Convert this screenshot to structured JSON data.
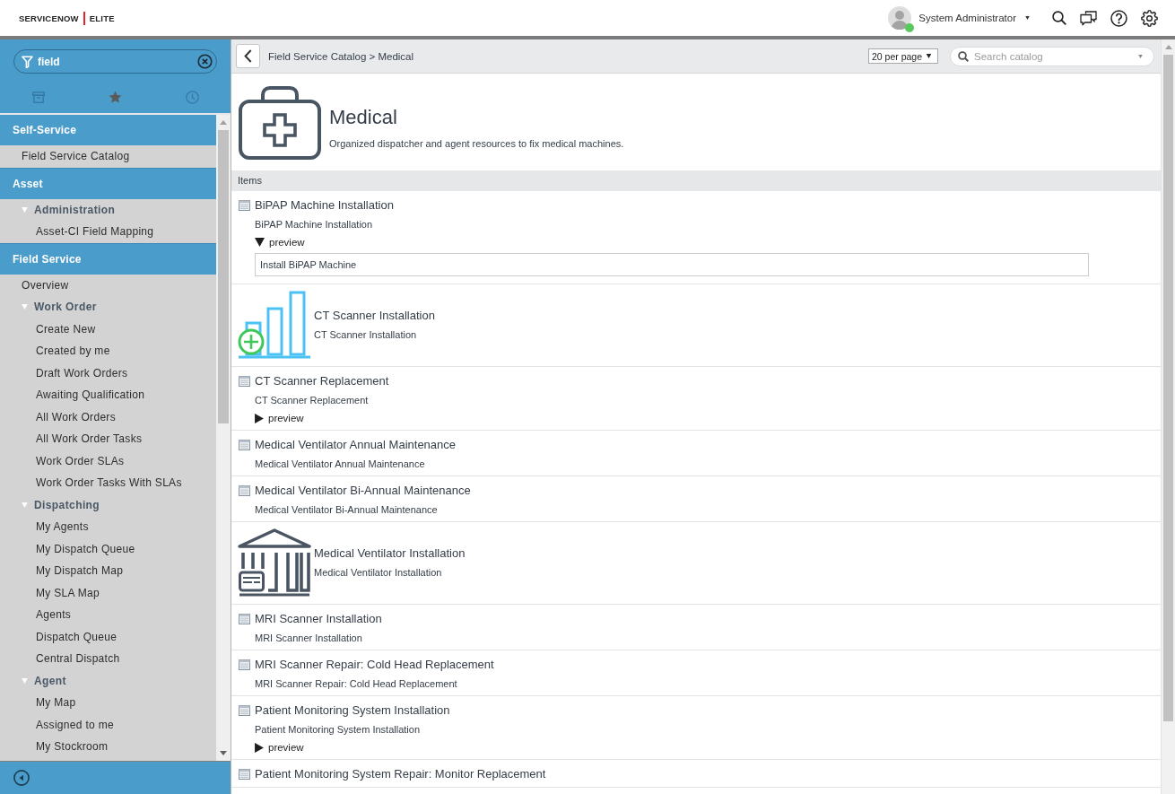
{
  "header": {
    "logo": {
      "brand": "SERVICENOW",
      "edition": "ELITE"
    },
    "user": {
      "name": "System Administrator",
      "online": true
    }
  },
  "nav": {
    "filter": {
      "value": "field"
    },
    "tabs": [
      {
        "selected": false
      },
      {
        "selected": true
      },
      {
        "selected": false
      }
    ],
    "sections": [
      {
        "title": "Self-Service",
        "children": [
          {
            "label": "Field Service Catalog"
          }
        ]
      },
      {
        "title": "Asset",
        "children": [
          {
            "label": "Administration",
            "expanded": true,
            "children": [
              {
                "label": "Asset-CI Field Mapping"
              }
            ]
          }
        ]
      },
      {
        "title": "Field Service",
        "children": [
          {
            "label": "Overview"
          },
          {
            "label": "Work Order",
            "expanded": true,
            "children": [
              {
                "label": "Create New"
              },
              {
                "label": "Created by me"
              },
              {
                "label": "Draft Work Orders"
              },
              {
                "label": "Awaiting Qualification"
              },
              {
                "label": "All Work Orders"
              },
              {
                "label": "All Work Order Tasks"
              },
              {
                "label": "Work Order SLAs"
              },
              {
                "label": "Work Order Tasks With SLAs"
              }
            ]
          },
          {
            "label": "Dispatching",
            "expanded": true,
            "children": [
              {
                "label": "My Agents"
              },
              {
                "label": "My Dispatch Queue"
              },
              {
                "label": "My Dispatch Map"
              },
              {
                "label": "My SLA Map"
              },
              {
                "label": "Agents"
              },
              {
                "label": "Dispatch Queue"
              },
              {
                "label": "Central Dispatch"
              }
            ]
          },
          {
            "label": "Agent",
            "expanded": true,
            "children": [
              {
                "label": "My Map"
              },
              {
                "label": "Assigned to me"
              },
              {
                "label": "My Stockroom"
              }
            ]
          }
        ]
      }
    ]
  },
  "toolbar": {
    "breadcrumb": "Field Service Catalog > Medical",
    "per_page": "20 per page",
    "search": {
      "placeholder": "Search catalog"
    }
  },
  "category": {
    "title": "Medical",
    "description": "Organized dispatcher and agent resources to fix medical machines."
  },
  "items_heading": "Items",
  "items": [
    {
      "kind": "standard",
      "title": "BiPAP Machine Installation",
      "description": "BiPAP Machine Installation",
      "preview": {
        "label": "preview",
        "expanded": true,
        "text": "Install BiPAP Machine"
      }
    },
    {
      "kind": "chart",
      "title": "CT Scanner Installation",
      "description": "CT Scanner Installation"
    },
    {
      "kind": "standard",
      "title": "CT Scanner Replacement",
      "description": "CT Scanner Replacement",
      "preview": {
        "label": "preview",
        "expanded": false
      }
    },
    {
      "kind": "standard",
      "title": "Medical Ventilator Annual Maintenance",
      "description": "Medical Ventilator Annual Maintenance"
    },
    {
      "kind": "standard",
      "title": "Medical Ventilator Bi-Annual Maintenance",
      "description": "Medical Ventilator Bi-Annual Maintenance"
    },
    {
      "kind": "building",
      "title": "Medical Ventilator Installation",
      "description": "Medical Ventilator Installation"
    },
    {
      "kind": "standard",
      "title": "MRI Scanner Installation",
      "description": "MRI Scanner Installation"
    },
    {
      "kind": "standard",
      "title": "MRI Scanner Repair: Cold Head Replacement",
      "description": "MRI Scanner Repair: Cold Head Replacement"
    },
    {
      "kind": "standard",
      "title": "Patient Monitoring System Installation",
      "description": "Patient Monitoring System Installation",
      "preview": {
        "label": "preview",
        "expanded": false
      }
    },
    {
      "kind": "standard",
      "title": "Patient Monitoring System Repair: Monitor Replacement"
    }
  ]
}
